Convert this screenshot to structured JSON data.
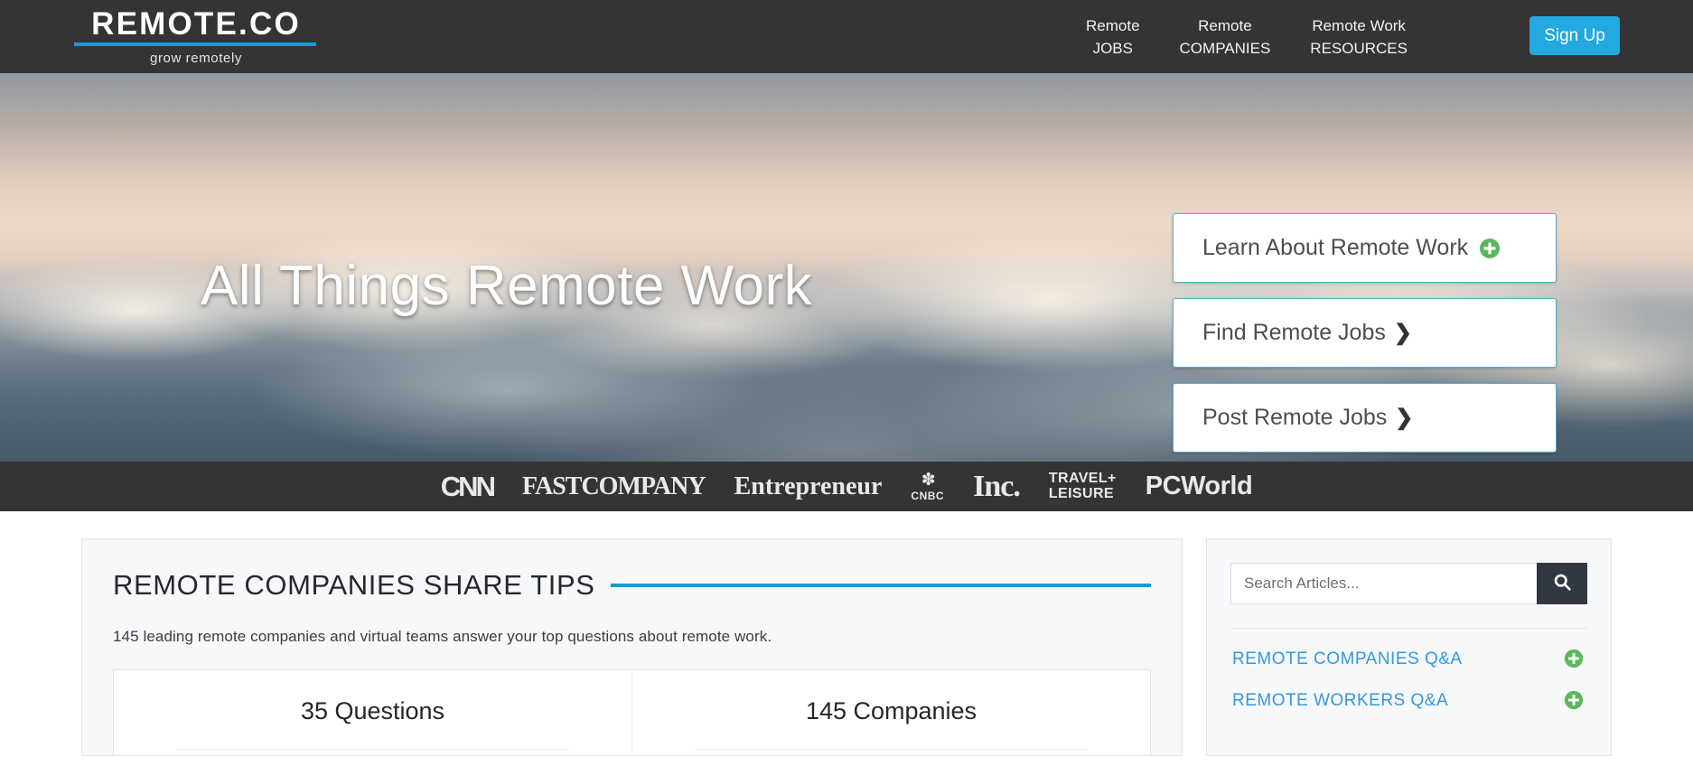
{
  "brand": {
    "logo_word": "REMOTE.CO",
    "tagline": "grow remotely",
    "accent_blue": "#1b9ad6",
    "dark_bar": "#343434",
    "signup_blue": "#23a8e0",
    "green": "#5cb85c",
    "link_blue": "#3598db"
  },
  "nav": {
    "items": [
      {
        "line1": "Remote",
        "line2": "JOBS"
      },
      {
        "line1": "Remote",
        "line2": "COMPANIES"
      },
      {
        "line1": "Remote Work",
        "line2": "RESOURCES"
      }
    ],
    "signup_label": "Sign Up"
  },
  "hero": {
    "title": "All Things Remote Work",
    "ctas": [
      {
        "label": "Learn About Remote Work",
        "icon": "plus-circle-icon"
      },
      {
        "label": "Find Remote Jobs",
        "icon": "chevron-right-icon"
      },
      {
        "label": "Post Remote Jobs",
        "icon": "chevron-right-icon"
      }
    ]
  },
  "press": {
    "logos": [
      {
        "name": "cnn",
        "text": "CNN"
      },
      {
        "name": "fast-company",
        "text": "FASTCOMPANY"
      },
      {
        "name": "entrepreneur",
        "text": "Entrepreneur"
      },
      {
        "name": "cnbc",
        "peacock": "✽",
        "text": "CNBC"
      },
      {
        "name": "inc",
        "text": "Inc."
      },
      {
        "name": "travel-leisure",
        "line1": "TRAVEL+",
        "line2": "LEISURE"
      },
      {
        "name": "pcworld",
        "text": "PCWorld"
      }
    ]
  },
  "main": {
    "section_title": "REMOTE COMPANIES SHARE TIPS",
    "section_sub": "145 leading remote companies and virtual teams answer your top questions about remote work.",
    "stats": [
      {
        "label": "35 Questions",
        "value": 35,
        "unit": "Questions"
      },
      {
        "label": "145 Companies",
        "value": 145,
        "unit": "Companies"
      }
    ]
  },
  "sidebar": {
    "search": {
      "placeholder": "Search Articles...",
      "value": "",
      "button_icon": "search-icon"
    },
    "qa_links": [
      {
        "label": "REMOTE COMPANIES Q&A",
        "icon": "plus-circle-icon"
      },
      {
        "label": "REMOTE WORKERS Q&A",
        "icon": "plus-circle-icon"
      }
    ]
  }
}
